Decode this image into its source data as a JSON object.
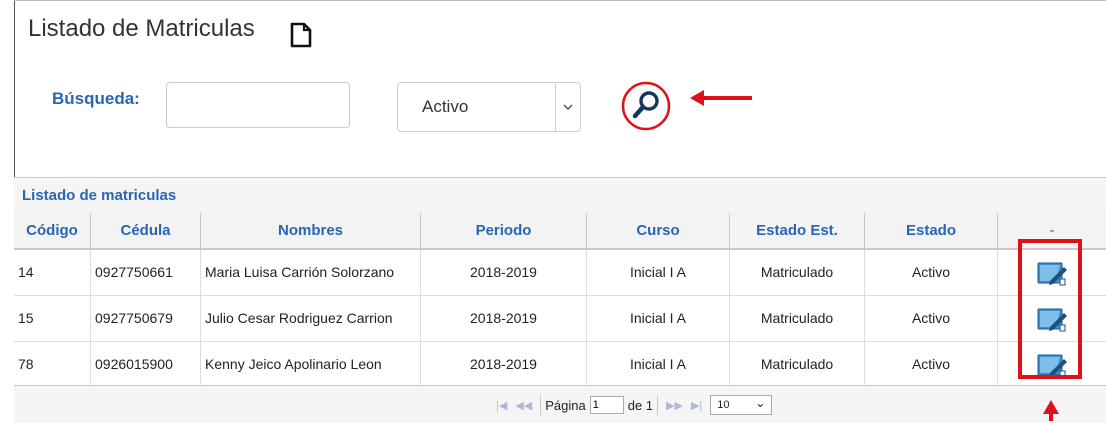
{
  "page": {
    "title": "Listado de Matriculas"
  },
  "search": {
    "label": "Búsqueda:",
    "value": "",
    "placeholder": ""
  },
  "status_filter": {
    "selected": "Activo"
  },
  "grid": {
    "caption": "Listado de matriculas",
    "columns": [
      "Código",
      "Cédula",
      "Nombres",
      "Periodo",
      "Curso",
      "Estado Est.",
      "Estado",
      "-"
    ],
    "rows": [
      {
        "codigo": "14",
        "cedula": "0927750661",
        "nombres": "Maria Luisa Carrión Solorzano",
        "periodo": "2018-2019",
        "curso": "Inicial I A",
        "estado_est": "Matriculado",
        "estado": "Activo"
      },
      {
        "codigo": "15",
        "cedula": "0927750679",
        "nombres": "Julio Cesar Rodriguez Carrion",
        "periodo": "2018-2019",
        "curso": "Inicial I A",
        "estado_est": "Matriculado",
        "estado": "Activo"
      },
      {
        "codigo": "78",
        "cedula": "0926015900",
        "nombres": "Kenny Jeico Apolinario Leon",
        "periodo": "2018-2019",
        "curso": "Inicial I A",
        "estado_est": "Matriculado",
        "estado": "Activo"
      }
    ]
  },
  "pager": {
    "page_label": "Página",
    "page_value": "1",
    "of_label": "de 1",
    "page_size": "10"
  },
  "colors": {
    "accent_blue": "#2a65b5",
    "annotation_red": "#e0101a"
  },
  "icons": {
    "new_document": "document-icon",
    "search": "magnifier-icon",
    "row_action": "edit-enrollment-icon"
  }
}
